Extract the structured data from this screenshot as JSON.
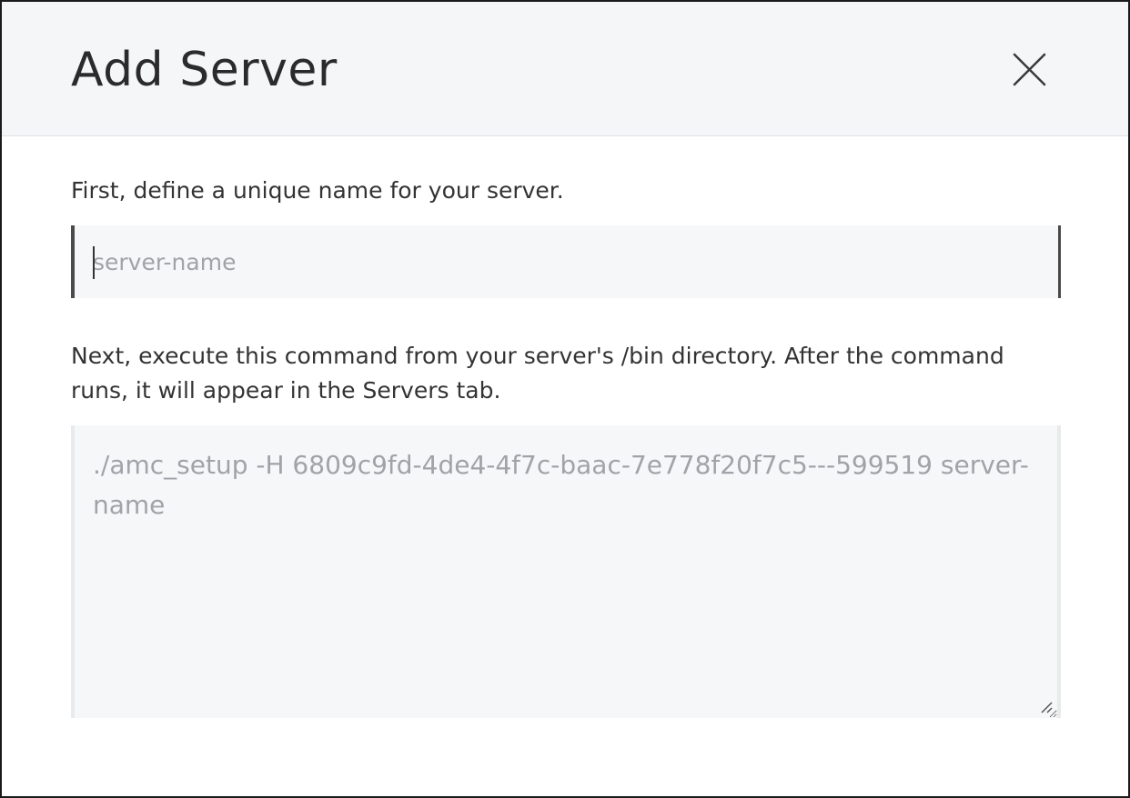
{
  "dialog": {
    "title": "Add Server",
    "close_icon": "close-icon"
  },
  "step1": {
    "label": "First, define a unique name for your server.",
    "input": {
      "value": "",
      "placeholder": "server-name"
    }
  },
  "step2": {
    "label": "Next, execute this command from your server's /bin directory. After the command runs, it will appear in the Servers tab.",
    "command": "./amc_setup -H 6809c9fd-4de4-4f7c-baac-7e778f20f7c5---599519 server-name"
  },
  "colors": {
    "header_bg": "#f5f6f8",
    "field_bg": "#f6f7f9",
    "text": "#333333",
    "placeholder": "#a0a3a7",
    "active_border": "#4a4a4a"
  }
}
